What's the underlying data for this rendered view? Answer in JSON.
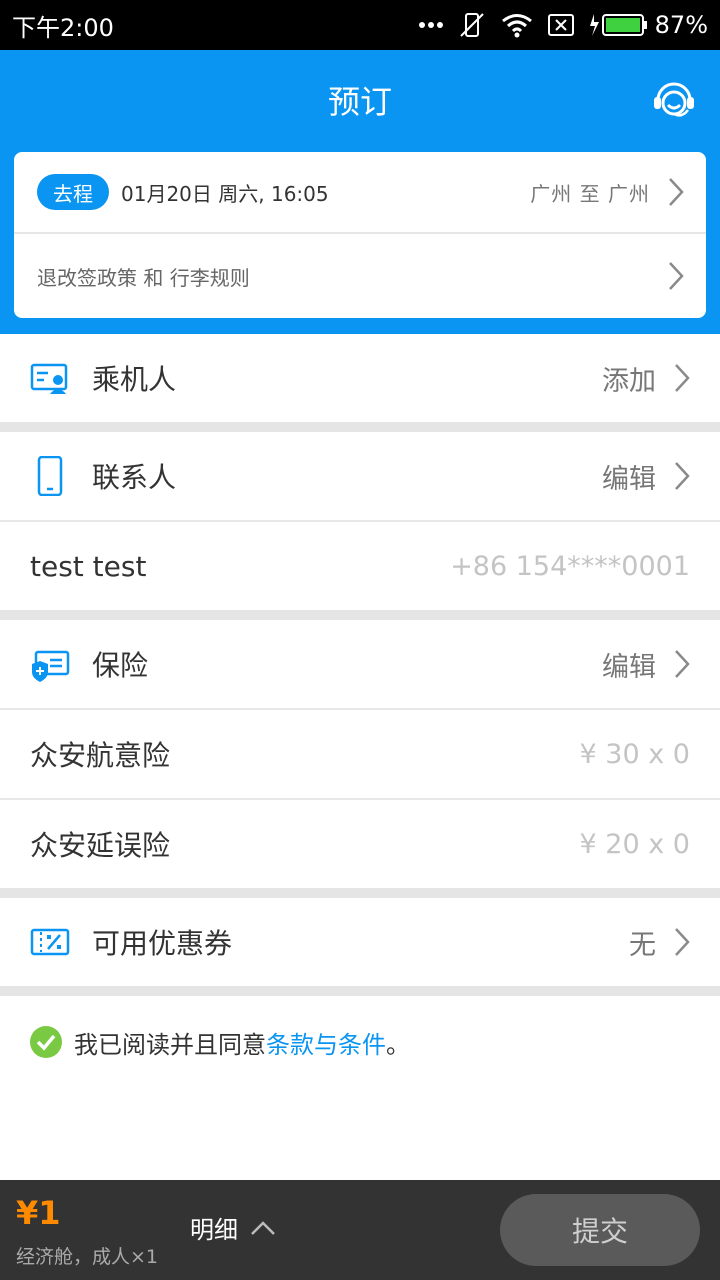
{
  "status_bar": {
    "time": "下午2:00",
    "battery": "87%"
  },
  "header": {
    "title": "预订"
  },
  "trip": {
    "badge": "去程",
    "datetime": "01月20日 周六, 16:05",
    "route": "广州 至 广州",
    "policy_link": "退改签政策 和 行李规则"
  },
  "passenger": {
    "label": "乘机人",
    "action": "添加"
  },
  "contact": {
    "label": "联系人",
    "action": "编辑",
    "name": "test test",
    "phone": "+86 154****0001"
  },
  "insurance": {
    "label": "保险",
    "action": "编辑",
    "items": [
      {
        "name": "众安航意险",
        "price": "¥ 30 x 0"
      },
      {
        "name": "众安延误险",
        "price": "¥ 20 x 0"
      }
    ]
  },
  "coupon": {
    "label": "可用优惠券",
    "value": "无"
  },
  "agreement": {
    "text": "我已阅读并且同意 ",
    "link": "条款与条件",
    "suffix": "。"
  },
  "bottom_bar": {
    "price": "¥1",
    "fare_desc": "经济舱，成人×1",
    "detail_label": "明细",
    "submit_label": "提交"
  },
  "colors": {
    "primary": "#0a95f2",
    "price": "#ff8a00",
    "check": "#7ac943",
    "bottom_bar": "#333333"
  },
  "icons": [
    "mute-icon",
    "wifi-icon",
    "no-sim-icon",
    "battery-icon",
    "customer-service-icon",
    "chevron-right-icon",
    "passenger-card-icon",
    "phone-icon",
    "insurance-icon",
    "coupon-icon",
    "check-circle-icon",
    "chevron-up-icon"
  ]
}
